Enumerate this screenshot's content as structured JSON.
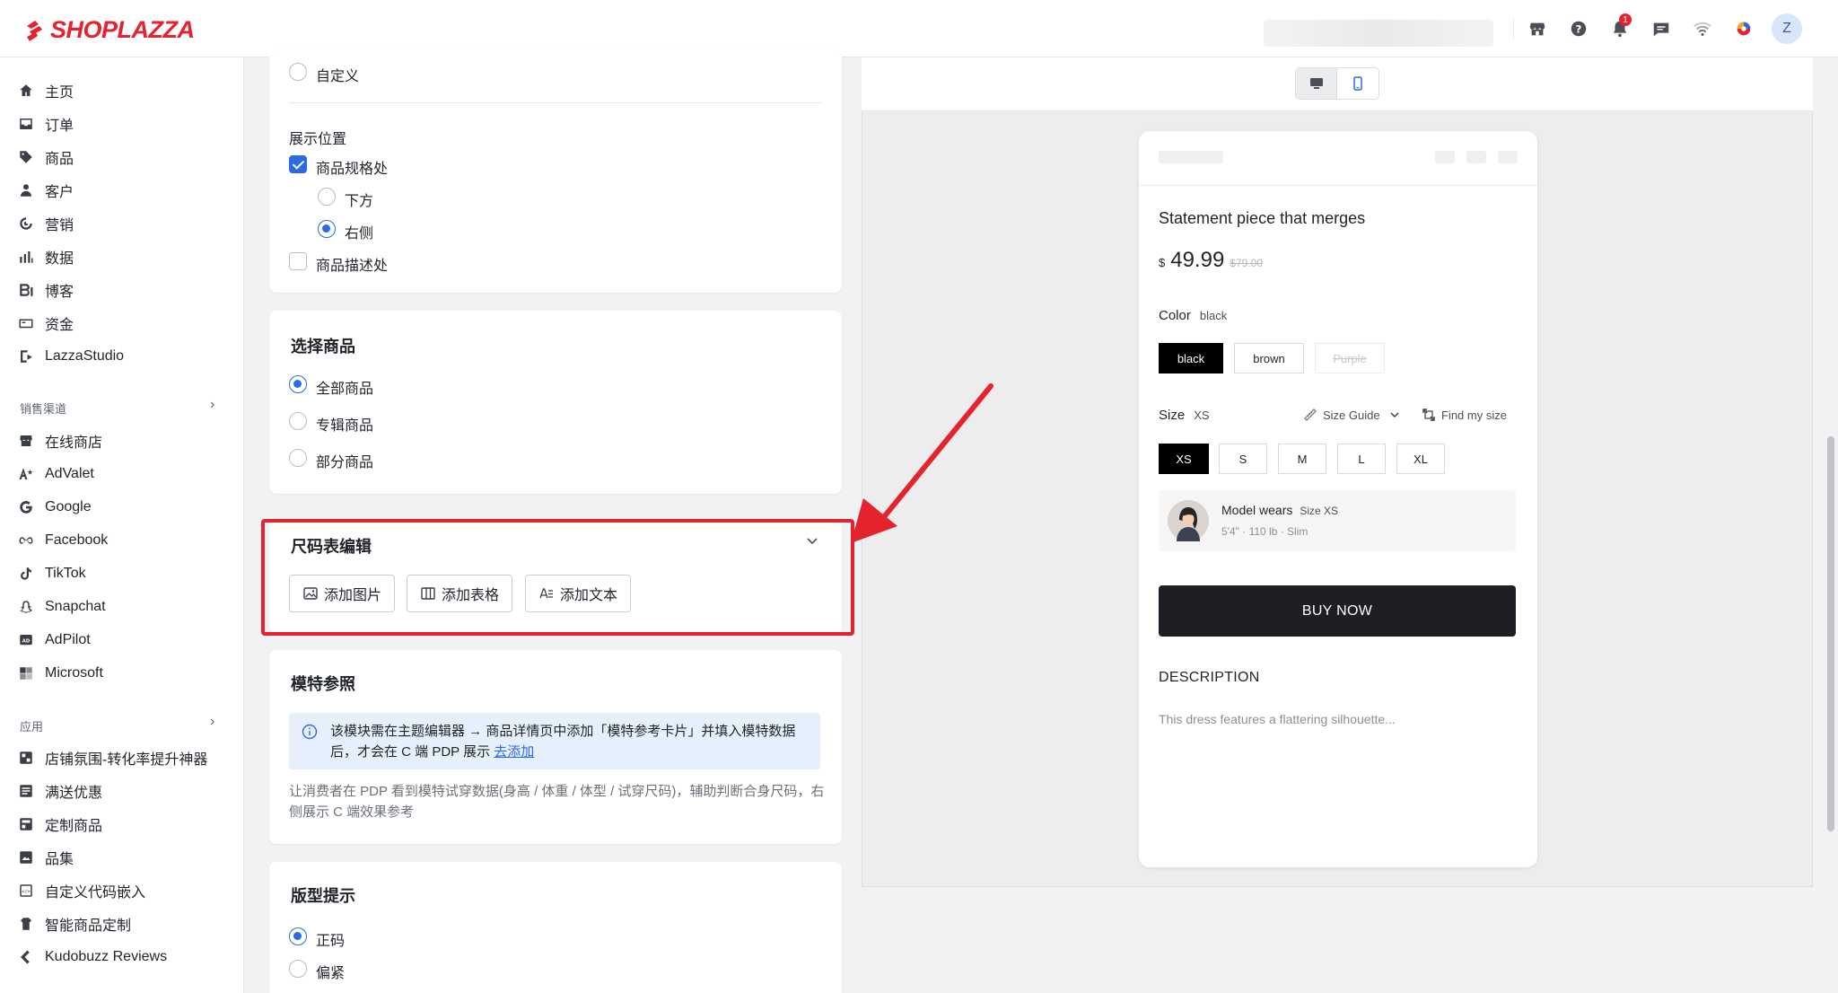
{
  "brand": {
    "name": "SHOPLAZZA",
    "color": "#e5232f"
  },
  "topbar": {
    "notification_count": "1",
    "avatar_initial": "Z"
  },
  "sidebar": {
    "main_items": [
      {
        "label": "主页",
        "icon": "home-icon"
      },
      {
        "label": "订单",
        "icon": "inbox-icon"
      },
      {
        "label": "商品",
        "icon": "tag-icon"
      },
      {
        "label": "客户",
        "icon": "person-icon"
      },
      {
        "label": "营销",
        "icon": "target-icon"
      },
      {
        "label": "数据",
        "icon": "bar-chart-icon"
      },
      {
        "label": "博客",
        "icon": "blog-icon"
      },
      {
        "label": "资金",
        "icon": "wallet-icon"
      },
      {
        "label": "LazzaStudio",
        "icon": "studio-icon"
      }
    ],
    "channels_title": "销售渠道",
    "channels": [
      {
        "label": "在线商店",
        "icon": "store-icon"
      },
      {
        "label": "AdValet",
        "icon": "advalet-icon"
      },
      {
        "label": "Google",
        "icon": "google-icon"
      },
      {
        "label": "Facebook",
        "icon": "meta-icon"
      },
      {
        "label": "TikTok",
        "icon": "tiktok-icon"
      },
      {
        "label": "Snapchat",
        "icon": "snapchat-icon"
      },
      {
        "label": "AdPilot",
        "icon": "adpilot-icon"
      },
      {
        "label": "Microsoft",
        "icon": "microsoft-icon"
      }
    ],
    "apps_title": "应用",
    "apps": [
      {
        "label": "店铺氛围-转化率提升神器",
        "icon": "app-icon"
      },
      {
        "label": "满送优惠",
        "icon": "app-icon"
      },
      {
        "label": "定制商品",
        "icon": "app-icon"
      },
      {
        "label": "品集",
        "icon": "app-icon"
      },
      {
        "label": "自定义代码嵌入",
        "icon": "app-icon"
      },
      {
        "label": "智能商品定制",
        "icon": "app-icon"
      },
      {
        "label": "Kudobuzz Reviews",
        "icon": "app-icon"
      }
    ]
  },
  "display_card": {
    "custom_option": "自定义",
    "position_title": "展示位置",
    "spec_option": "商品规格处",
    "below_option": "下方",
    "right_option": "右侧",
    "desc_option": "商品描述处"
  },
  "select_card": {
    "title": "选择商品",
    "options": [
      "全部商品",
      "专辑商品",
      "部分商品"
    ]
  },
  "size_chart_card": {
    "title": "尺码表编辑",
    "buttons": [
      "添加图片",
      "添加表格",
      "添加文本"
    ]
  },
  "model_card": {
    "title": "模特参照",
    "info_text": "该模块需在主题编辑器 → 商品详情页中添加「模特参考卡片」并填入模特数据后，才会在 C 端 PDP 展示 ",
    "info_link": "去添加",
    "hint": "让消费者在 PDP 看到模特试穿数据(身高 / 体重 / 体型 / 试穿尺码)，辅助判断合身尺码，右侧展示 C 端效果参考"
  },
  "fit_card": {
    "title": "版型提示",
    "options": [
      "正码",
      "偏紧"
    ]
  },
  "preview": {
    "product_title": "Statement piece that merges",
    "currency": "$",
    "price": "49.99",
    "compare_price": "$79.00",
    "color_label": "Color",
    "color_value": "black",
    "colors": [
      "black",
      "brown",
      "Purple"
    ],
    "size_label": "Size",
    "size_value": "XS",
    "size_guide": "Size Guide",
    "find_size": "Find my size",
    "sizes": [
      "XS",
      "S",
      "M",
      "L",
      "XL"
    ],
    "model_wears": "Model wears",
    "model_size": "Size XS",
    "model_stats": "5'4\" · 110 lb · Slim",
    "buy_now": "BUY NOW",
    "description_title": "DESCRIPTION",
    "description_text": "This dress features a flattering silhouette..."
  }
}
